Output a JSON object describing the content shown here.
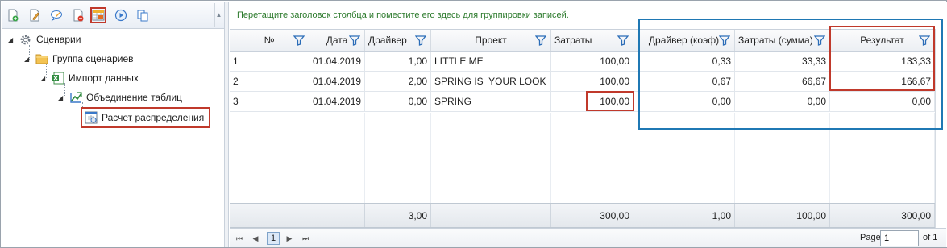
{
  "toolbar": {
    "buttons": [
      "add-icon",
      "edit-icon",
      "comment-icon",
      "delete-icon",
      "table-icon",
      "play-icon",
      "copy-icon"
    ]
  },
  "tree": {
    "root": "Сценарии",
    "group": "Группа сценариев",
    "import": "Импорт данных",
    "merge": "Объединение таблиц",
    "calc": "Расчет распределения"
  },
  "grid": {
    "group_hint": "Перетащите заголовок столбца и поместите его здесь для группировки записей.",
    "columns": {
      "num": "№",
      "date": "Дата",
      "driver": "Драйвер",
      "project": "Проект",
      "cost": "Затраты",
      "driver_coef": "Драйвер (коэф)",
      "cost_sum": "Затраты (сумма)",
      "result": "Результат"
    },
    "rows": [
      {
        "num": "1",
        "date": "01.04.2019",
        "driver": "1,00",
        "project": "LITTLE ME",
        "cost": "100,00",
        "driver_coef": "0,33",
        "cost_sum": "33,33",
        "result": "133,33"
      },
      {
        "num": "2",
        "date": "01.04.2019",
        "driver": "2,00",
        "project": "SPRING IS  YOUR LOOK",
        "cost": "100,00",
        "driver_coef": "0,67",
        "cost_sum": "66,67",
        "result": "166,67"
      },
      {
        "num": "3",
        "date": "01.04.2019",
        "driver": "0,00",
        "project": "SPRING",
        "cost": "100,00",
        "driver_coef": "0,00",
        "cost_sum": "0,00",
        "result": "0,00"
      }
    ],
    "totals": {
      "driver": "3,00",
      "cost": "300,00",
      "driver_coef": "1,00",
      "cost_sum": "100,00",
      "result": "300,00"
    }
  },
  "pager": {
    "current_page": "1",
    "page_label": "Page",
    "page_value": "1",
    "of_label": "of 1"
  },
  "colors": {
    "highlight_red": "#c0392b",
    "highlight_blue": "#1f78b4",
    "hint_green": "#2c7a2c"
  }
}
